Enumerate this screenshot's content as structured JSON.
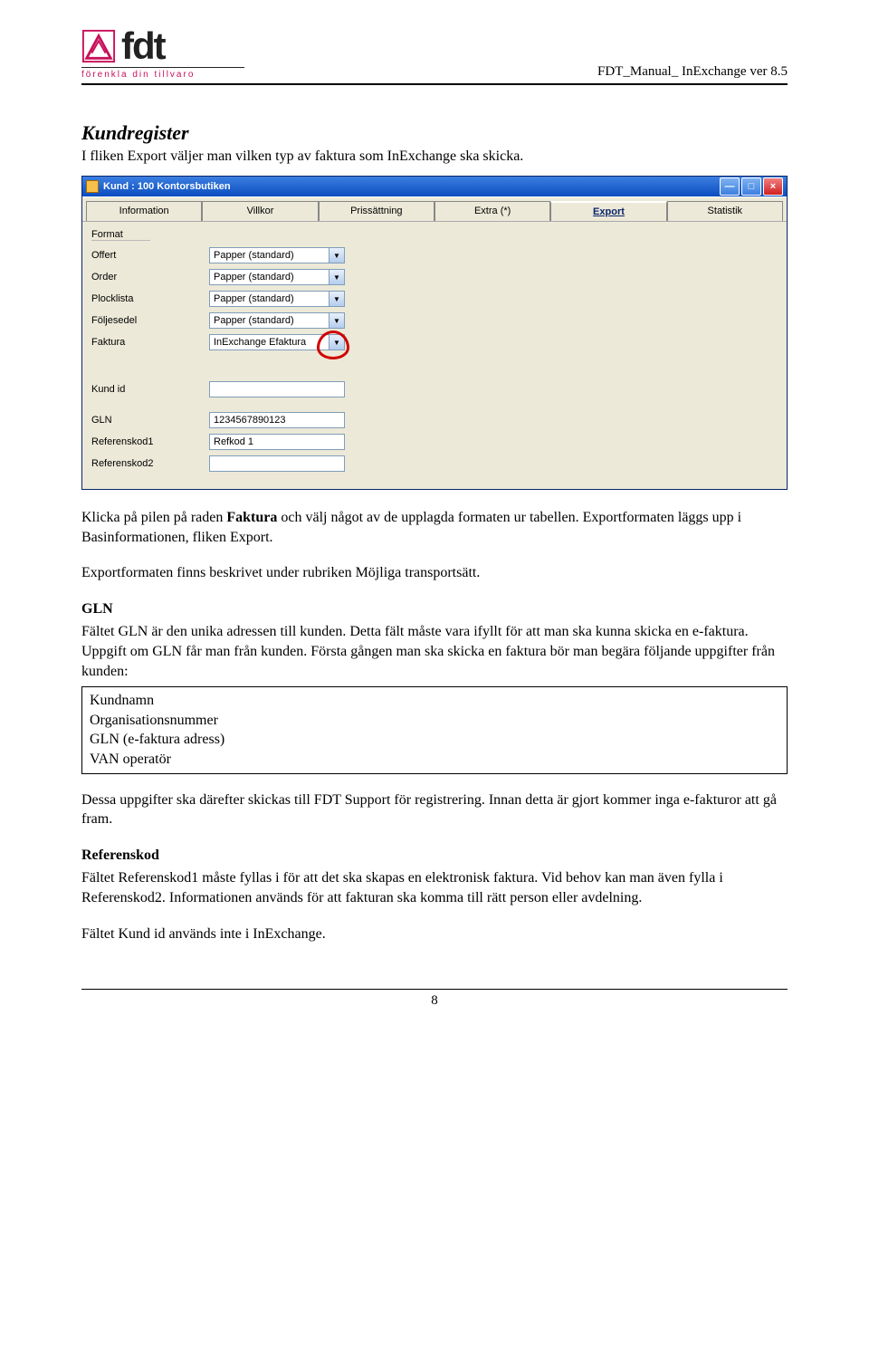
{
  "header": {
    "logo_text": "fdt",
    "tagline": "förenkla din tillvaro",
    "doc_title": "FDT_Manual_ InExchange ver 8.5"
  },
  "section": {
    "title": "Kundregister",
    "intro": "I fliken Export väljer man vilken typ av faktura som InExchange ska skicka."
  },
  "window": {
    "title": "Kund : 100 Kontorsbutiken",
    "tabs": [
      "Information",
      "Villkor",
      "Prissättning",
      "Extra (*)",
      "Export",
      "Statistik"
    ],
    "selected_tab": "Export",
    "group_label": "Format",
    "rows": {
      "offert": {
        "label": "Offert",
        "value": "Papper (standard)"
      },
      "order": {
        "label": "Order",
        "value": "Papper (standard)"
      },
      "plocklista": {
        "label": "Plocklista",
        "value": "Papper (standard)"
      },
      "foljesedel": {
        "label": "Följesedel",
        "value": "Papper (standard)"
      },
      "faktura": {
        "label": "Faktura",
        "value": "InExchange Efaktura"
      }
    },
    "kund_id": {
      "label": "Kund id",
      "value": ""
    },
    "gln": {
      "label": "GLN",
      "value": "1234567890123"
    },
    "ref1": {
      "label": "Referenskod1",
      "value": "Refkod 1"
    },
    "ref2": {
      "label": "Referenskod2",
      "value": ""
    }
  },
  "body": {
    "p1_a": "Klicka på pilen på raden ",
    "p1_bold": "Faktura",
    "p1_b": " och välj något av de upplagda formaten ur tabellen. Exportformaten läggs upp i Basinformationen, fliken Export.",
    "p2": "Exportformaten finns beskrivet under rubriken Möjliga transportsätt.",
    "gln_title": "GLN",
    "gln_body": "Fältet GLN är den unika adressen till kunden. Detta fält måste vara ifyllt för att man ska kunna skicka en e-faktura. Uppgift om GLN får man från kunden. Första gången man ska skicka en faktura bör man begära följande uppgifter från kunden:",
    "box": [
      "Kundnamn",
      "Organisationsnummer",
      "GLN (e-faktura adress)",
      "VAN operatör"
    ],
    "p4": "Dessa uppgifter ska därefter skickas till FDT Support för registrering. Innan detta är gjort kommer inga e-fakturor att gå fram.",
    "ref_title": "Referenskod",
    "ref_body": "Fältet Referenskod1 måste fyllas i för att det ska skapas en elektronisk faktura. Vid behov kan man även fylla i Referenskod2. Informationen används för att fakturan ska komma till rätt person eller avdelning.",
    "p6": "Fältet Kund id används inte i InExchange."
  },
  "page_number": "8"
}
